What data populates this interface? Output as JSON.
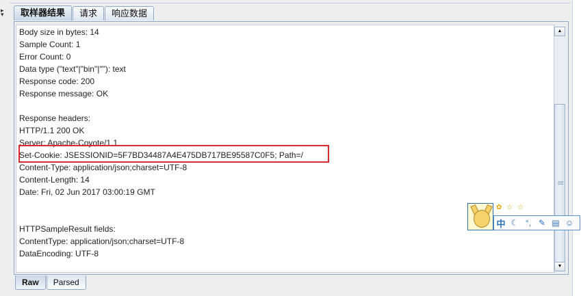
{
  "tabs": [
    {
      "label": "取样器结果"
    },
    {
      "label": "请求"
    },
    {
      "label": "响应数据"
    }
  ],
  "result_lines": [
    "Body size in bytes: 14",
    "Sample Count: 1",
    "Error Count: 0",
    "Data type (\"text\"|\"bin\"|\"\"): text",
    "Response code: 200",
    "Response message: OK",
    "",
    "Response headers:",
    "HTTP/1.1 200 OK",
    "Server: Apache-Coyote/1.1",
    "Set-Cookie: JSESSIONID=5F7BD34487A4E475DB717BE95587C0F5; Path=/",
    "Content-Type: application/json;charset=UTF-8",
    "Content-Length: 14",
    "Date: Fri, 02 Jun 2017 03:00:19 GMT",
    "",
    "",
    "HTTPSampleResult fields:",
    "ContentType: application/json;charset=UTF-8",
    "DataEncoding: UTF-8"
  ],
  "bottom_tabs": [
    {
      "label": "Raw"
    },
    {
      "label": "Parsed"
    }
  ],
  "ime_toolbar": {
    "mode": "中",
    "icons": [
      "moon-icon",
      "punctuation-icon",
      "wrench-icon",
      "clipboard-icon",
      "smiley-icon"
    ],
    "stars": "✿ ☆ ☆"
  },
  "colors": {
    "highlight": "#e0272e",
    "panel_border": "#8ea9c7"
  },
  "highlighted_line_index": 10
}
